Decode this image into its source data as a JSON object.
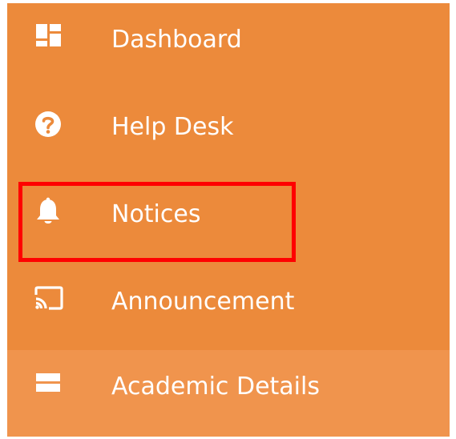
{
  "sidebar": {
    "items": [
      {
        "label": "Dashboard",
        "icon": "dashboard-icon"
      },
      {
        "label": "Help Desk",
        "icon": "help-circle-icon"
      },
      {
        "label": "Notices",
        "icon": "bell-icon"
      },
      {
        "label": "Announcement",
        "icon": "cast-icon"
      },
      {
        "label": "Academic Details",
        "icon": "credit-card-icon"
      }
    ],
    "highlighted_item": "Notices",
    "active_item": "Academic Details"
  },
  "colors": {
    "sidebar_bg": "#ec8a3b",
    "active_bg": "#f0944d",
    "text": "#ffffff",
    "highlight_border": "#ff0000"
  }
}
